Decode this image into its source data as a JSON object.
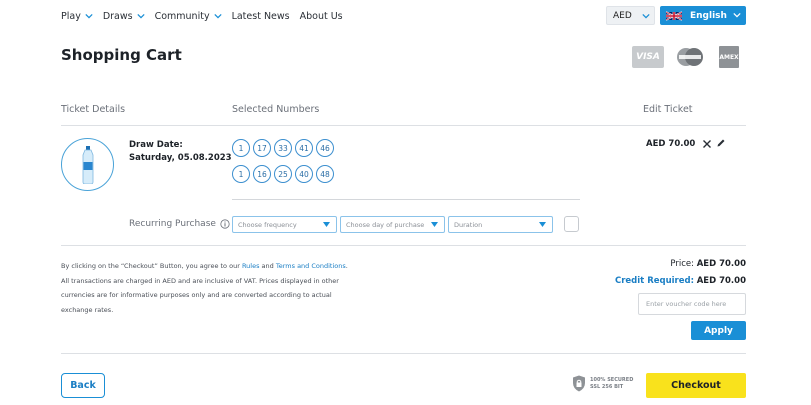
{
  "nav": {
    "items": [
      {
        "label": "Play",
        "dropdown": true
      },
      {
        "label": "Draws",
        "dropdown": true
      },
      {
        "label": "Community",
        "dropdown": true
      },
      {
        "label": "Latest News",
        "dropdown": false
      },
      {
        "label": "About Us",
        "dropdown": false
      }
    ]
  },
  "header": {
    "currency": "AED",
    "language": "English"
  },
  "page_title": "Shopping Cart",
  "payment_cards": {
    "visa": "VISA",
    "mastercard": "MasterCard",
    "amex": "AMEX"
  },
  "table": {
    "col_ticket": "Ticket Details",
    "col_numbers": "Selected Numbers",
    "col_edit": "Edit Ticket"
  },
  "ticket": {
    "draw_label": "Draw Date:",
    "draw_date": "Saturday, 05.08.2023",
    "lines": [
      [
        "1",
        "17",
        "33",
        "41",
        "46"
      ],
      [
        "1",
        "16",
        "25",
        "40",
        "48"
      ]
    ],
    "price": "AED 70.00"
  },
  "recurring": {
    "label": "Recurring Purchase",
    "frequency_placeholder": "Choose frequency",
    "day_placeholder": "Choose day of purchase",
    "duration_placeholder": "Duration"
  },
  "terms": {
    "part1": "By clicking on the “Checkout” Button, you agree to our ",
    "rules_link": "Rules",
    "part2": " and ",
    "terms_link": "Terms and Conditions",
    "part3": ".",
    "line2": "All transactions are charged in AED and are inclusive of VAT. Prices displayed in other currencies are for informative purposes only and are converted according to actual exchange rates."
  },
  "summary": {
    "price_label": "Price:",
    "price_value": "AED 70.00",
    "credit_label": "Credit Required:",
    "credit_value": "AED 70.00",
    "voucher_placeholder": "Enter voucher code here",
    "apply_label": "Apply"
  },
  "footer": {
    "back_label": "Back",
    "secure_line1": "100% SECURED",
    "secure_line2": "SSL 256 BIT",
    "checkout_label": "Checkout"
  },
  "colors": {
    "primary": "#1a8fd6",
    "checkout": "#f9e21c"
  }
}
